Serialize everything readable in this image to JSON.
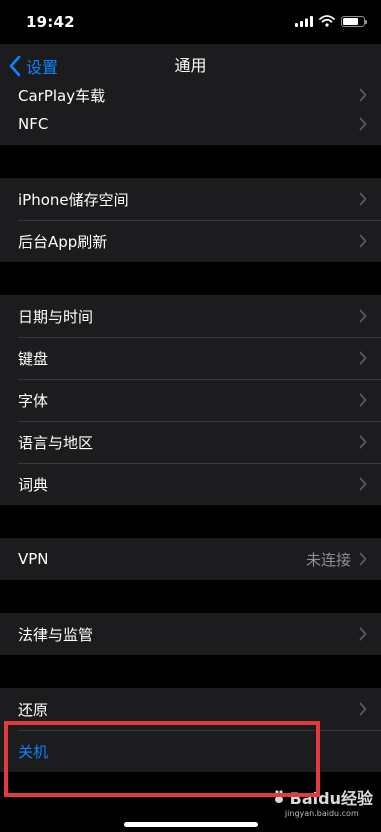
{
  "status_bar": {
    "time": "19:42"
  },
  "nav": {
    "back_label": "设置",
    "title": "通用"
  },
  "partial_row_label": "CarPlay车载",
  "groups": [
    {
      "rows": [
        {
          "label": "NFC"
        }
      ]
    },
    {
      "rows": [
        {
          "label": "iPhone储存空间"
        },
        {
          "label": "后台App刷新"
        }
      ]
    },
    {
      "rows": [
        {
          "label": "日期与时间"
        },
        {
          "label": "键盘"
        },
        {
          "label": "字体"
        },
        {
          "label": "语言与地区"
        },
        {
          "label": "词典"
        }
      ]
    },
    {
      "rows": [
        {
          "label": "VPN",
          "value": "未连接"
        }
      ]
    },
    {
      "rows": [
        {
          "label": "法律与监管"
        }
      ]
    },
    {
      "rows": [
        {
          "label": "还原"
        },
        {
          "label": "关机"
        }
      ]
    }
  ],
  "watermark": {
    "brand": "Baidu经验",
    "url": "jingyan.baidu.com"
  },
  "colors": {
    "accent": "#0a84ff",
    "highlight": "#e23b3b",
    "background": "#000000",
    "cell": "#1c1c1e"
  }
}
